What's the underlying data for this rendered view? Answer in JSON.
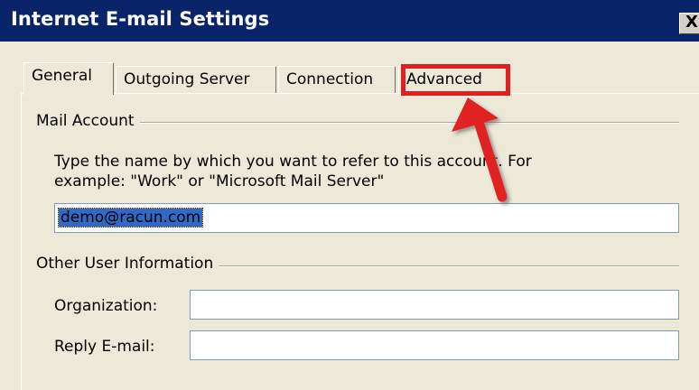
{
  "window": {
    "title": "Internet E-mail Settings",
    "close_glyph": "✕"
  },
  "tabs": [
    {
      "label": "General",
      "active": true
    },
    {
      "label": "Outgoing Server",
      "active": false
    },
    {
      "label": "Connection",
      "active": false
    },
    {
      "label": "Advanced",
      "active": false,
      "highlighted": true
    }
  ],
  "mail_account": {
    "group_label": "Mail Account",
    "description_line1": "Type the name by which you want to refer to this account. For",
    "description_line2": "example: \"Work\" or \"Microsoft Mail Server\"",
    "account_name_value": "demo@racun.com"
  },
  "other_user_info": {
    "group_label": "Other User Information",
    "organization_label": "Organization:",
    "organization_value": "",
    "reply_email_label": "Reply E-mail:",
    "reply_email_value": ""
  },
  "annotation": {
    "highlight_color": "#e02020",
    "arrow_icon": "red-arrow-icon"
  }
}
